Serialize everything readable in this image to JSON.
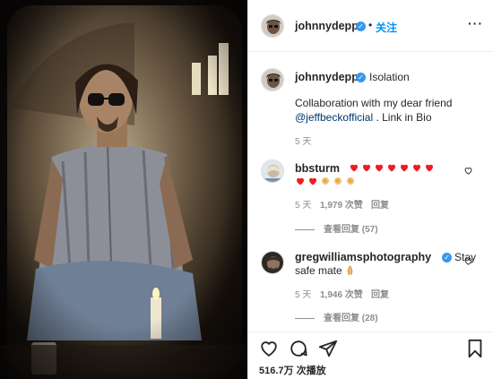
{
  "post": {
    "photo_description_icon": "post-photo",
    "likes_count": "516.7万",
    "likes_suffix": "次播放"
  },
  "header": {
    "username": "johnnydepp",
    "separator": "•",
    "follow_label": "关注",
    "more_icon": "more-options-icon"
  },
  "caption": {
    "username": "johnnydepp",
    "title": "Isolation",
    "line1": "Collaboration with my dear friend",
    "mention": "@jeffbeckofficial",
    "line2_rest": " . Link in Bio",
    "time": "5 天"
  },
  "comments": [
    {
      "username": "bbsturm",
      "time": "5 天",
      "likes": "1,979 次赞",
      "reply_label": "回复",
      "view_replies": "查看回复 (57)"
    },
    {
      "username": "gregwilliamsphotography",
      "text_line1": "Stay",
      "text_line2": "safe mate",
      "time": "5 天",
      "likes": "1,946 次赞",
      "reply_label": "回复",
      "view_replies": "查看回复 (28)"
    }
  ],
  "colors": {
    "link": "#00376b",
    "follow": "#0095f6",
    "verified": "#3897f0",
    "heart": "#ed4956"
  }
}
